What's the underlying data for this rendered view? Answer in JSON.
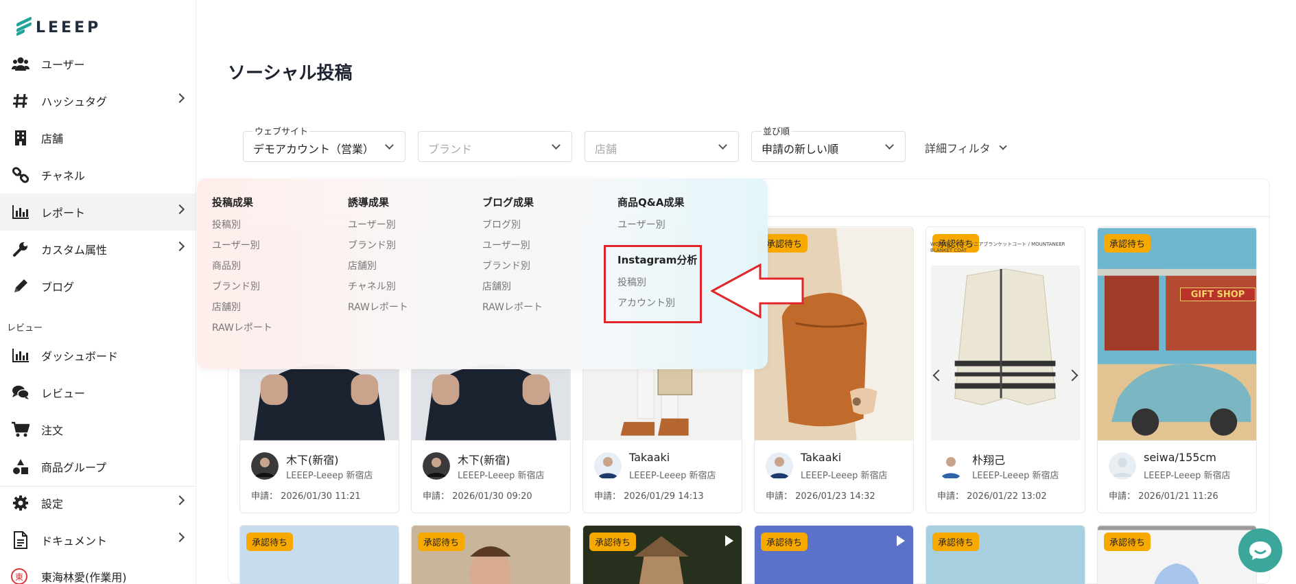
{
  "brand": {
    "logo_text": "LEEEP"
  },
  "sidebar": {
    "items": [
      {
        "label": "ユーザー",
        "icon": "users-icon",
        "chevron": false
      },
      {
        "label": "ハッシュタグ",
        "icon": "hashtag-icon",
        "chevron": true
      },
      {
        "label": "店舗",
        "icon": "building-icon",
        "chevron": false
      },
      {
        "label": "チャネル",
        "icon": "link-icon",
        "chevron": false
      },
      {
        "label": "レポート",
        "icon": "bar-chart-icon",
        "chevron": true,
        "active": true
      },
      {
        "label": "カスタム属性",
        "icon": "wrench-icon",
        "chevron": true
      },
      {
        "label": "ブログ",
        "icon": "pencil-icon",
        "chevron": false
      }
    ],
    "section_label": "レビュー",
    "review_items": [
      {
        "label": "ダッシュボード",
        "icon": "bar-chart-icon"
      },
      {
        "label": "レビュー",
        "icon": "comments-icon"
      },
      {
        "label": "注文",
        "icon": "cart-icon"
      },
      {
        "label": "商品グループ",
        "icon": "shapes-icon"
      }
    ],
    "bottom_items": [
      {
        "label": "設定",
        "icon": "gear-icon",
        "chevron": true
      },
      {
        "label": "ドキュメント",
        "icon": "document-icon",
        "chevron": true
      }
    ],
    "current_user": {
      "badge": "東",
      "name": "東海林愛(作業用)"
    }
  },
  "page": {
    "title": "ソーシャル投稿"
  },
  "filters": {
    "website": {
      "label": "ウェブサイト",
      "value": "デモアカウント（営業）"
    },
    "brand": {
      "placeholder": "ブランド"
    },
    "store": {
      "placeholder": "店舗"
    },
    "sort": {
      "label": "並び順",
      "value": "申請の新しい順"
    },
    "detail": "詳細フィルタ"
  },
  "report_menu": {
    "columns": [
      {
        "heading": "投稿成果",
        "links": [
          "投稿別",
          "ユーザー別",
          "商品別",
          "ブランド別",
          "店舗別",
          "RAWレポート"
        ]
      },
      {
        "heading": "誘導成果",
        "links": [
          "ユーザー別",
          "ブランド別",
          "店舗別",
          "チャネル別",
          "RAWレポート"
        ]
      },
      {
        "heading": "ブログ成果",
        "links": [
          "ブログ別",
          "ユーザー別",
          "ブランド別",
          "店舗別",
          "RAWレポート"
        ]
      },
      {
        "heading": "商品Q&A成果",
        "links": [
          "ユーザー別"
        ]
      }
    ],
    "instagram": {
      "heading": "Instagram分析",
      "links": [
        "投稿別",
        "アカウント別"
      ]
    }
  },
  "posts": [
    {
      "name": "木下(新宿)",
      "store": "LEEEP-Leeep 新宿店",
      "applied": "申請： 2026/01/30 11:21",
      "badge": ""
    },
    {
      "name": "木下(新宿)",
      "store": "LEEEP-Leeep 新宿店",
      "applied": "申請： 2026/01/30 09:20",
      "badge": ""
    },
    {
      "name": "Takaaki",
      "store": "LEEEP-Leeep 新宿店",
      "applied": "申請： 2026/01/29 14:13",
      "badge": ""
    },
    {
      "name": "Takaaki",
      "store": "LEEEP-Leeep 新宿店",
      "applied": "申請： 2026/01/23 14:32",
      "badge": "承認待ち"
    },
    {
      "name": "朴翔己",
      "store": "LEEEP-Leeep 新宿店",
      "applied": "申請： 2026/01/22 13:02",
      "badge": "承認待ち"
    },
    {
      "name": "seiwa/155cm",
      "store": "LEEEP-Leeep 新宿店",
      "applied": "申請： 2026/01/21 11:26",
      "badge": "承認待ち"
    }
  ],
  "image_texts": {
    "coat_caption": "WOMAN / マウンテニアブランケットコート / MOUNTANEER BLANKET COAT",
    "gift_sign": "GIFT SHOP"
  },
  "second_row_badges": [
    "承認待ち",
    "承認待ち",
    "承認待ち",
    "承認待ち",
    "承認待ち",
    "承認待ち"
  ],
  "colors": {
    "accent": "#22a39a",
    "badge": "#f7a900",
    "highlight": "#e0262a",
    "chat": "#3ba79b"
  }
}
